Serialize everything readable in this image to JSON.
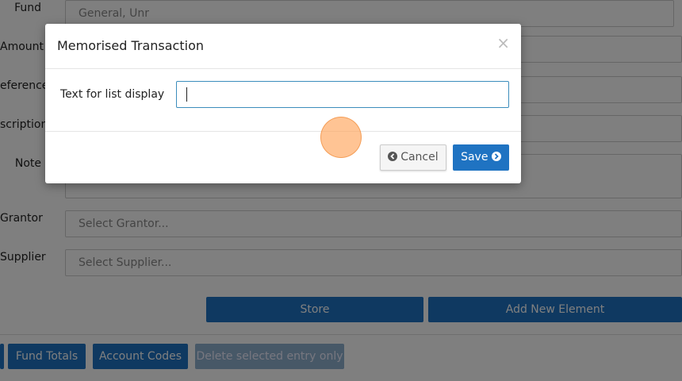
{
  "form": {
    "labels": {
      "fund": "Fund",
      "amount": "Amount",
      "reference": "eference",
      "description": "scription",
      "note": "Note",
      "grantor": "Grantor",
      "supplier": "Supplier"
    },
    "fund_value": "General, Unr",
    "grantor_placeholder": "Select Grantor...",
    "supplier_placeholder": "Select Supplier...",
    "store_label": "Store",
    "add_new_label": "Add New Element"
  },
  "toolbar": {
    "fund_totals": "Fund Totals",
    "account_codes": "Account Codes",
    "delete_entry": "Delete selected entry only"
  },
  "modal": {
    "title": "Memorised Transaction",
    "close": "×",
    "field_label": "Text for list display",
    "field_value": "",
    "cancel_label": "Cancel",
    "save_label": "Save",
    "cancel_icon": "arrow-left-circle-icon",
    "save_icon": "arrow-right-circle-icon"
  },
  "colors": {
    "primary": "#1f73c2",
    "input_focus": "#3c8dbc",
    "overlay": "rgba(0,0,0,0.5)"
  }
}
